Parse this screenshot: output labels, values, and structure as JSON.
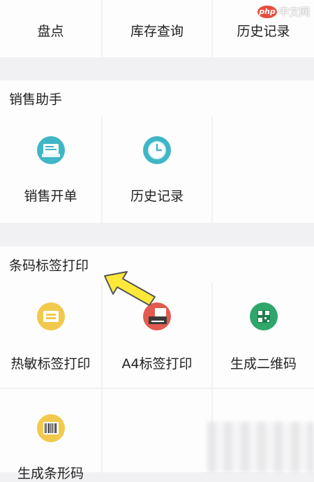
{
  "top_row": [
    "盘点",
    "库存查询",
    "历史记录"
  ],
  "sections": [
    {
      "title": "销售助手",
      "items": [
        {
          "label": "销售开单",
          "icon": "sales-order-icon"
        },
        {
          "label": "历史记录",
          "icon": "clock-icon"
        }
      ]
    },
    {
      "title": "条码标签打印",
      "items": [
        {
          "label": "热敏标签打印",
          "icon": "thermal-label-icon"
        },
        {
          "label": "A4标签打印",
          "icon": "a4-printer-icon"
        },
        {
          "label": "生成二维码",
          "icon": "qr-code-icon"
        },
        {
          "label": "生成条形码",
          "icon": "barcode-icon"
        }
      ]
    }
  ],
  "watermark": {
    "logo": "php",
    "text": "中文网"
  },
  "colors": {
    "teal": "#3fb6c6",
    "yellow": "#f2c94c",
    "red": "#e35a4f",
    "green": "#2fa66a",
    "arrow": "#ffe83a"
  }
}
